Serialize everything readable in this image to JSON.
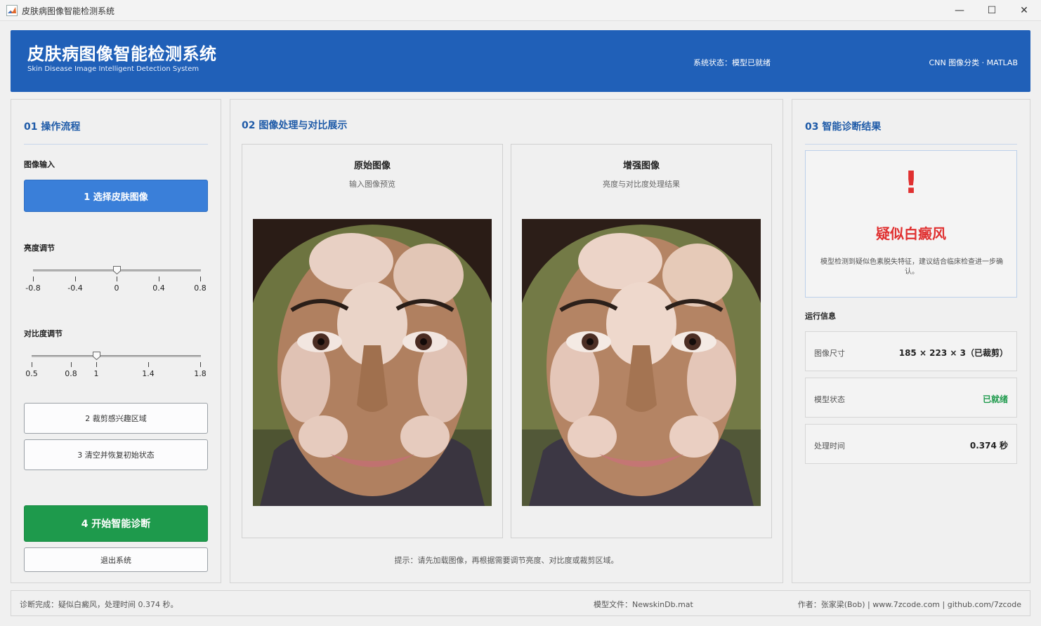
{
  "window": {
    "title": "皮肤病图像智能检测系统",
    "controls": {
      "minimize": "—",
      "maximize": "☐",
      "close": "✕"
    }
  },
  "header": {
    "title": "皮肤病图像智能检测系统",
    "subtitle": "Skin Disease Image Intelligent Detection System",
    "status": "系统状态：模型已就绪",
    "tech": "CNN 图像分类 · MATLAB"
  },
  "left_panel": {
    "title": "01  操作流程",
    "input_label": "图像输入",
    "select_button": "1  选择皮肤图像",
    "brightness": {
      "label": "亮度调节",
      "value": 0,
      "min": -0.8,
      "max": 0.8,
      "ticks": [
        "-0.8",
        "-0.4",
        "0",
        "0.4",
        "0.8"
      ]
    },
    "contrast": {
      "label": "对比度调节",
      "value": 1,
      "min": 0.5,
      "max": 1.8,
      "ticks": [
        "0.5",
        "0.8",
        "1",
        "1.4",
        "1.8"
      ]
    },
    "crop_button": "2  裁剪感兴趣区域",
    "reset_button": "3  清空并恢复初始状态",
    "diagnose_button": "4  开始智能诊断",
    "exit_button": "退出系统"
  },
  "center_panel": {
    "title": "02  图像处理与对比展示",
    "original": {
      "title": "原始图像",
      "subtitle": "输入图像预览"
    },
    "enhanced": {
      "title": "增强图像",
      "subtitle": "亮度与对比度处理结果"
    },
    "hint": "提示：请先加载图像，再根据需要调节亮度、对比度或裁剪区域。"
  },
  "right_panel": {
    "title": "03  智能诊断结果",
    "alert_symbol": "!",
    "diagnosis": "疑似白癜风",
    "description": "模型检测到疑似色素脱失特征，建议结合临床检查进一步确认。",
    "run_info_label": "运行信息",
    "info": [
      {
        "key": "图像尺寸",
        "value": "185 × 223 × 3（已裁剪）"
      },
      {
        "key": "模型状态",
        "value": "已就绪"
      },
      {
        "key": "处理时间",
        "value": "0.374 秒"
      }
    ]
  },
  "statusbar": {
    "left": "诊断完成：疑似白癜风，处理时间 0.374 秒。",
    "center": "模型文件：NewskinDb.mat",
    "right": "作者：张家梁(Bob) | www.7zcode.com | github.com/7zcode"
  },
  "colors": {
    "header_bg": "#2060b8",
    "accent_blue": "#3a7fd9",
    "diagnose_green": "#1e9a4c",
    "alert_red": "#e03030",
    "ready_green": "#1e9a4c"
  }
}
